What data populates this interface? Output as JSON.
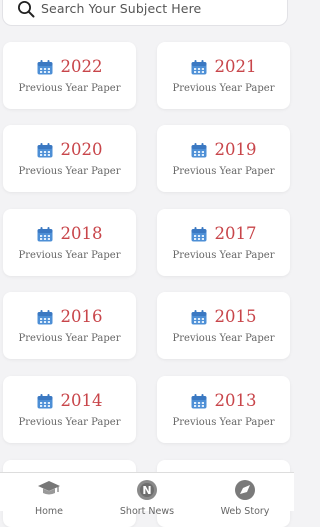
{
  "search": {
    "placeholder": "Search Your Subject Here"
  },
  "cards": [
    {
      "year": "2022",
      "subtitle": "Previous Year Paper"
    },
    {
      "year": "2021",
      "subtitle": "Previous Year Paper"
    },
    {
      "year": "2020",
      "subtitle": "Previous Year Paper"
    },
    {
      "year": "2019",
      "subtitle": "Previous Year Paper"
    },
    {
      "year": "2018",
      "subtitle": "Previous Year Paper"
    },
    {
      "year": "2017",
      "subtitle": "Previous Year Paper"
    },
    {
      "year": "2016",
      "subtitle": "Previous Year Paper"
    },
    {
      "year": "2015",
      "subtitle": "Previous Year Paper"
    },
    {
      "year": "2014",
      "subtitle": "Previous Year Paper"
    },
    {
      "year": "2013",
      "subtitle": "Previous Year Paper"
    }
  ],
  "colors": {
    "year": "#c8454a",
    "calendar_icon": "#4d8fd6",
    "background": "#f3f3f5"
  },
  "nav": [
    {
      "label": "Home",
      "icon": "graduation-cap-icon"
    },
    {
      "label": "Short News",
      "icon": "news-icon"
    },
    {
      "label": "Web Story",
      "icon": "compass-icon"
    }
  ]
}
